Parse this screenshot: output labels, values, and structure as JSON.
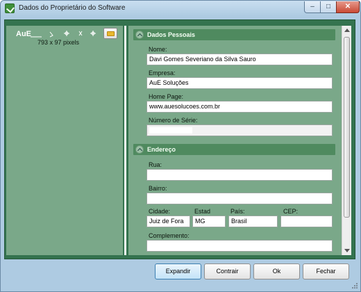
{
  "window": {
    "title": "Dados do Proprietário do Software",
    "controls": {
      "minimize": "–",
      "maximize": "□",
      "close": "✕"
    }
  },
  "logo": {
    "text": "AuE",
    "size_text": "793 x 97 pixels"
  },
  "sections": {
    "personal": {
      "title": "Dados Pessoais",
      "name_label": "Nome:",
      "name_value": "Davi Gomes Severiano da Silva Sauro",
      "company_label": "Empresa:",
      "company_value": "AuE Soluções",
      "homepage_label": "Home Page:",
      "homepage_value": "www.auesolucoes.com.br",
      "serial_label": "Número de Série:",
      "serial_value": ""
    },
    "address": {
      "title": "Endereço",
      "street_label": "Rua:",
      "street_value": "",
      "district_label": "Bairro:",
      "district_value": "",
      "city_label": "Cidade:",
      "city_value": "Juiz de Fora",
      "state_label": "Estad",
      "state_value": "MG",
      "country_label": "País:",
      "country_value": "Brasil",
      "zip_label": "CEP:",
      "zip_value": "",
      "complement_label": "Complemento:",
      "complement_value": ""
    }
  },
  "buttons": {
    "expand": "Expandir",
    "collapse": "Contrair",
    "ok": "Ok",
    "close": "Fechar"
  },
  "colors": {
    "client_bg": "#34734f",
    "pane_bg": "#7aa889",
    "section_header": "#4f8a5f"
  }
}
